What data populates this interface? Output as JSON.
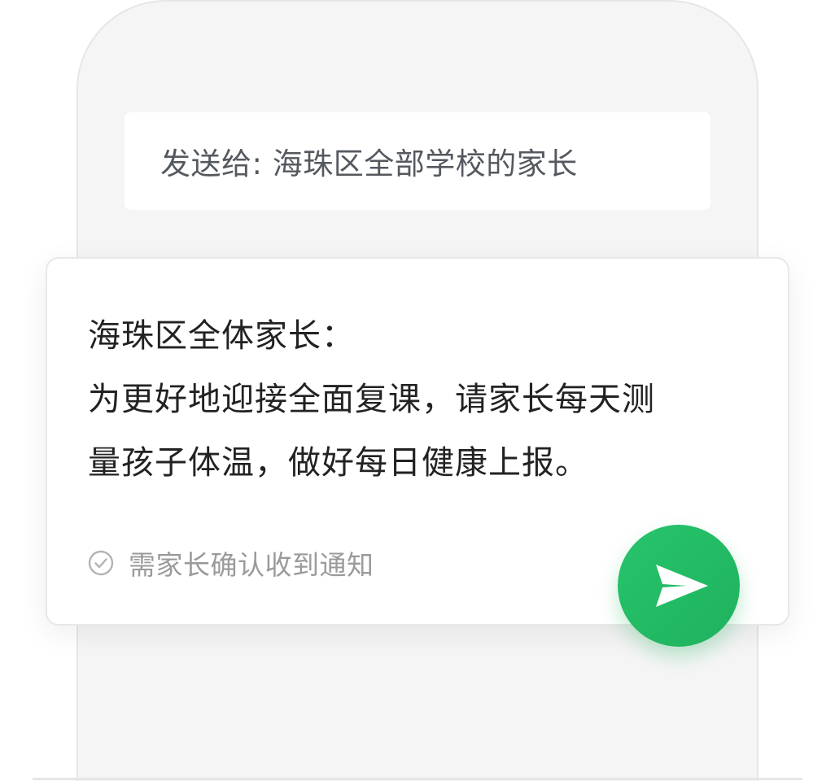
{
  "recipient": {
    "label": "发送给: 海珠区全部学校的家长"
  },
  "message": {
    "lines": [
      "海珠区全体家长：",
      "为更好地迎接全面复课，请家长每天测",
      "量孩子体温，做好每日健康上报。"
    ]
  },
  "confirmation": {
    "label": "需家长确认收到通知",
    "icon": "check-circle-icon"
  },
  "send_button": {
    "icon": "send-icon",
    "color": "#22bb63"
  },
  "colors": {
    "phone_background": "#f5f5f5",
    "card_background": "#ffffff",
    "accent": "#22bb63"
  }
}
